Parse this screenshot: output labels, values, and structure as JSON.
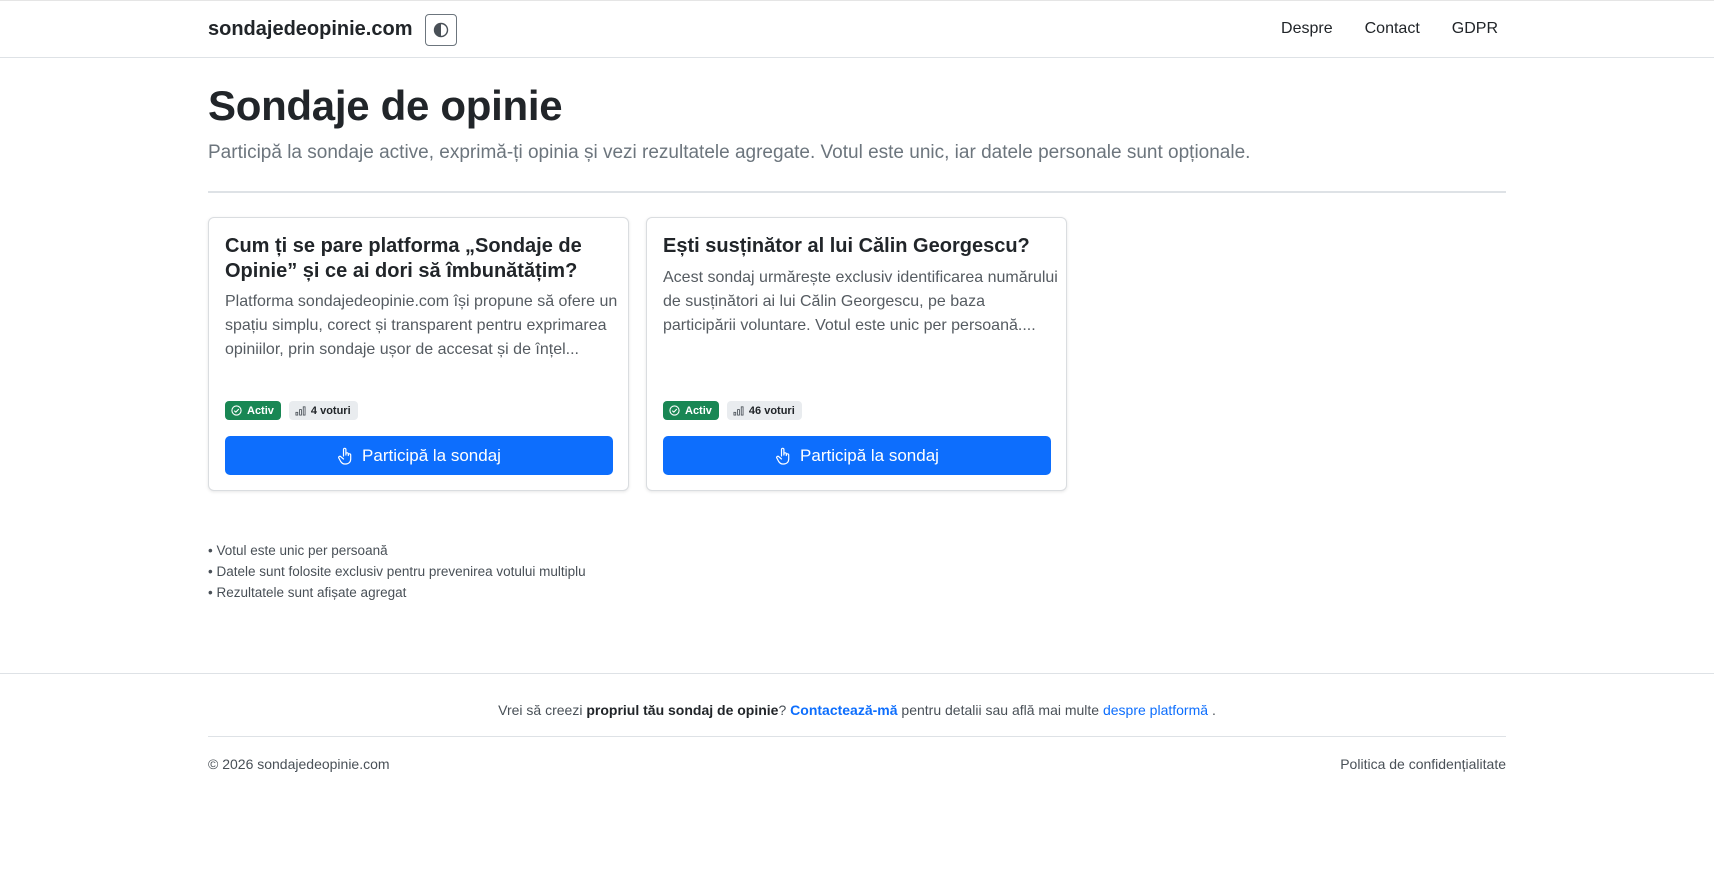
{
  "navbar": {
    "brand": "sondajedeopinie.com",
    "theme_toggle_icon": "contrast-icon",
    "links": [
      {
        "label": "Despre"
      },
      {
        "label": "Contact"
      },
      {
        "label": "GDPR"
      }
    ]
  },
  "header": {
    "title": "Sondaje de opinie",
    "lead": "Participă la sondaje active, exprimă-ți opinia și vezi rezultatele agregate. Votul este unic, iar datele personale sunt opționale."
  },
  "polls": [
    {
      "title": "Cum ți se pare platforma „Sondaje de Opinie” și ce ai dori să îmbunătățim?",
      "description": "Platforma sondajedeopinie.com își propune să ofere un spațiu simplu, corect și transparent pentru exprimarea opiniilor, prin sondaje ușor de accesat și de înțel...",
      "status": "Activ",
      "votes": "4 voturi",
      "button_label": "Participă la sondaj"
    },
    {
      "title": "Ești susținător al lui Călin Georgescu?",
      "description": "Acest sondaj urmărește exclusiv identificarea numărului de susținători ai lui Călin Georgescu, pe baza participării voluntare. Votul este unic per persoană....",
      "status": "Activ",
      "votes": "46 voturi",
      "button_label": "Participă la sondaj"
    }
  ],
  "notes": [
    "• Votul este unic per persoană",
    "• Datele sunt folosite exclusiv pentru prevenirea votului multiplu",
    "• Rezultatele sunt afișate agregat"
  ],
  "footer": {
    "cta_prefix": "Vrei să creezi",
    "cta_bold": "propriul tău sondaj de opinie",
    "cta_qmark": "?",
    "cta_contact_link": "Contactează-mă",
    "cta_middle": "pentru detalii sau află mai multe",
    "cta_about_link": "despre platformă",
    "cta_suffix": ".",
    "copyright": "© 2026 sondajedeopinie.com",
    "privacy_link": "Politica de confidențialitate"
  },
  "colors": {
    "primary": "#0d6efd",
    "success": "#198754",
    "muted": "#6c757d"
  }
}
